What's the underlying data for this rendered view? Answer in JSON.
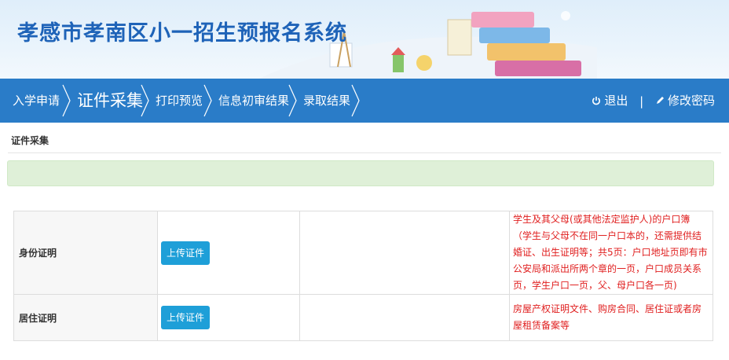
{
  "banner": {
    "title": "孝感市孝南区小一招生预报名系统"
  },
  "nav": {
    "items": [
      {
        "label": "入学申请"
      },
      {
        "label": "证件采集"
      },
      {
        "label": "打印预览"
      },
      {
        "label": "信息初审结果"
      },
      {
        "label": "录取结果"
      }
    ],
    "logout_label": "退出",
    "divider": "|",
    "change_password_label": "修改密码"
  },
  "section": {
    "title": "证件采集"
  },
  "documents": {
    "rows": [
      {
        "name": "身份证明",
        "button": "上传证件",
        "note": "学生及其父母(或其他法定监护人)的户口簿（学生与父母不在同一户口本的，还需提供结婚证、出生证明等；共5页：户口地址页即有市公安局和派出所两个章的一页，户口成员关系页，学生户口一页，父、母户口各一页)"
      },
      {
        "name": "居住证明",
        "button": "上传证件",
        "note": "房屋产权证明文件、购房合同、居住证或者房屋租赁备案等"
      }
    ]
  },
  "colors": {
    "nav_bg": "#2a7cc8",
    "title": "#1e63b8",
    "alert_bg": "#dff0d8",
    "button": "#1e9fd8",
    "note_text": "#e02020"
  }
}
